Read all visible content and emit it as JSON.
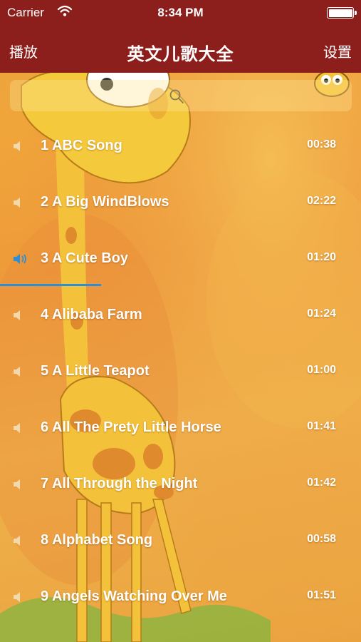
{
  "status_bar": {
    "carrier": "Carrier",
    "time": "8:34 PM",
    "battery_level": 1.0
  },
  "nav": {
    "left_label": "播放",
    "title": "英文儿歌大全",
    "right_label": "设置"
  },
  "search": {
    "icon": "search-icon"
  },
  "songs": [
    {
      "title": "1 ABC Song",
      "duration": "00:38",
      "playing": false
    },
    {
      "title": "2 A Big WindBlows",
      "duration": "02:22",
      "playing": false
    },
    {
      "title": "3 A Cute Boy",
      "duration": "01:20",
      "playing": true
    },
    {
      "title": "4 Alibaba Farm",
      "duration": "01:24",
      "playing": false
    },
    {
      "title": "5 A Little Teapot",
      "duration": "01:00",
      "playing": false
    },
    {
      "title": "6 All The Prety Little Horse",
      "duration": "01:41",
      "playing": false
    },
    {
      "title": "7 All Through the Night",
      "duration": "01:42",
      "playing": false
    },
    {
      "title": "8 Alphabet Song",
      "duration": "00:58",
      "playing": false
    },
    {
      "title": "9 Angels Watching Over Me",
      "duration": "01:51",
      "playing": false
    }
  ],
  "playback": {
    "progress": 0.28
  },
  "colors": {
    "bar": "#8c1f1c",
    "accent": "#2b8fd6",
    "speaker_inactive": "#f3e3c0",
    "speaker_active": "#2b8fd6"
  }
}
